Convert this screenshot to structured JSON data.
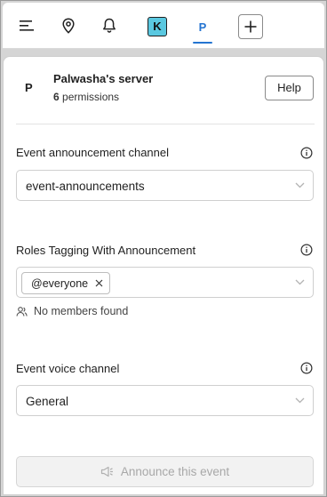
{
  "nav": {
    "items": [
      {
        "name": "menu",
        "icon": "hamburger-icon"
      },
      {
        "name": "location",
        "icon": "map-pin-icon"
      },
      {
        "name": "notifications",
        "icon": "bell-icon"
      }
    ],
    "server_k_letter": "K",
    "server_k_color": "#5ac8e0",
    "active_tab_letter": "P",
    "accent_color": "#2474d1",
    "add_icon": "plus-icon"
  },
  "server": {
    "letter": "P",
    "name": "Palwasha's server",
    "permissions_count": "6",
    "permissions_label": "permissions",
    "help_label": "Help"
  },
  "fields": {
    "announcement_channel": {
      "label": "Event announcement channel",
      "value": "event-announcements"
    },
    "roles": {
      "label": "Roles Tagging With Announcement",
      "chip": "@everyone",
      "empty_text": "No members found"
    },
    "voice_channel": {
      "label": "Event voice channel",
      "value": "General"
    }
  },
  "announce_button": {
    "label": "Announce this event",
    "icon": "megaphone-icon",
    "disabled": true
  }
}
